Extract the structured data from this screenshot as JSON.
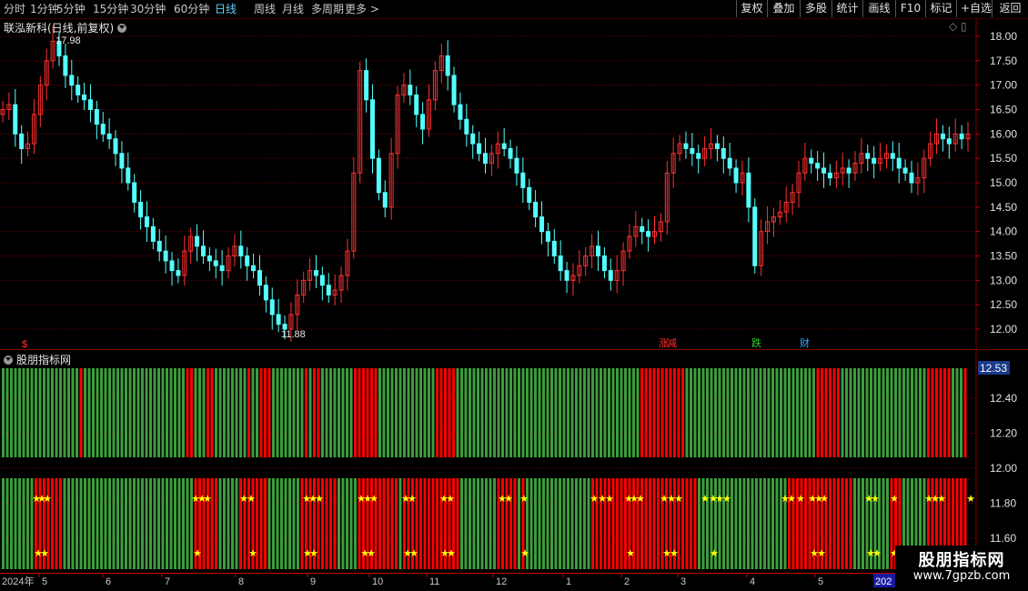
{
  "toolbar": {
    "timeframes": [
      {
        "label": "分时",
        "active": false
      },
      {
        "label": "1分钟",
        "active": false
      },
      {
        "label": "5分钟",
        "active": false
      },
      {
        "label": "15分钟",
        "active": false
      },
      {
        "label": "30分钟",
        "active": false
      },
      {
        "label": "60分钟",
        "active": false
      },
      {
        "label": "日线",
        "active": true
      },
      {
        "label": "周线",
        "active": false
      },
      {
        "label": "月线",
        "active": false
      },
      {
        "label": "多周期",
        "active": false
      },
      {
        "label": "更多 >",
        "active": false
      }
    ],
    "actions": [
      "复权",
      "叠加",
      "多股",
      "统计",
      "画线",
      "F10",
      "标记",
      "+自选",
      "返回"
    ]
  },
  "main_chart": {
    "title": "联泓新科(日线,前复权)",
    "high_label": "17.98",
    "low_label": "11.88",
    "events": [
      {
        "text": "涨",
        "color": "#ff3030"
      },
      {
        "text": "减",
        "color": "#ff3030"
      },
      {
        "text": "跌",
        "color": "#33cc33"
      },
      {
        "text": "财",
        "color": "#33aaff"
      }
    ],
    "dollar_marker": "$"
  },
  "indicator": {
    "title": "股朋指标网",
    "current_value": "12.53"
  },
  "x_axis": {
    "year_label": "2024年",
    "months": [
      "5",
      "6",
      "7",
      "8",
      "9",
      "10",
      "11",
      "12",
      "1",
      "2",
      "3",
      "4",
      "5"
    ],
    "partial_year": "202"
  },
  "watermark": {
    "title": "股朋指标网",
    "url": "www.7gpzb.com"
  },
  "colors": {
    "up": "#ff3030",
    "down": "#54ffff",
    "grid": "#7a0000",
    "bar_red": "#ff0000",
    "bar_green": "#3c9e3c",
    "star": "#ffff00"
  },
  "chart_data": {
    "type": "candlestick",
    "ylim": [
      11.7,
      18.2
    ],
    "y_ticks": [
      "18.00",
      "17.50",
      "17.00",
      "16.50",
      "16.00",
      "15.50",
      "15.00",
      "14.50",
      "14.00",
      "13.50",
      "13.00",
      "12.50",
      "12.00"
    ],
    "indicator_y_ticks": [
      "12.40",
      "12.20",
      "12.00",
      "11.80",
      "11.60"
    ],
    "close": [
      16.5,
      16.6,
      16.0,
      15.7,
      15.8,
      16.4,
      17.0,
      17.5,
      17.9,
      17.6,
      17.2,
      17.0,
      16.8,
      16.7,
      16.5,
      16.2,
      16.0,
      15.9,
      15.6,
      15.3,
      15.0,
      14.6,
      14.3,
      14.1,
      13.8,
      13.6,
      13.4,
      13.2,
      13.1,
      13.6,
      13.9,
      13.7,
      13.5,
      13.4,
      13.3,
      13.2,
      13.5,
      13.7,
      13.5,
      13.3,
      13.2,
      12.9,
      12.6,
      12.3,
      12.1,
      12.0,
      12.3,
      12.7,
      13.0,
      13.2,
      13.1,
      12.9,
      12.7,
      12.8,
      13.1,
      13.6,
      15.2,
      17.3,
      16.7,
      15.5,
      14.8,
      14.5,
      15.6,
      16.8,
      17.0,
      16.8,
      16.4,
      16.1,
      16.7,
      17.3,
      17.6,
      17.2,
      16.6,
      16.3,
      16.0,
      15.8,
      15.6,
      15.4,
      15.6,
      15.8,
      15.7,
      15.5,
      15.2,
      14.9,
      14.6,
      14.3,
      14.0,
      13.8,
      13.5,
      13.2,
      13.0,
      13.1,
      13.3,
      13.5,
      13.7,
      13.5,
      13.2,
      13.0,
      13.2,
      13.6,
      13.9,
      14.1,
      14.0,
      13.9,
      14.0,
      14.2,
      15.2,
      15.6,
      15.8,
      15.7,
      15.6,
      15.5,
      15.7,
      15.8,
      15.7,
      15.5,
      15.3,
      15.0,
      15.2,
      14.5,
      13.3,
      14.0,
      14.2,
      14.3,
      14.4,
      14.6,
      14.8,
      15.2,
      15.5,
      15.4,
      15.3,
      15.2,
      15.1,
      15.2,
      15.3,
      15.2,
      15.4,
      15.6,
      15.5,
      15.4,
      15.5,
      15.6,
      15.5,
      15.3,
      15.2,
      15.0,
      15.1,
      15.5,
      15.8,
      16.0,
      15.9,
      15.8,
      16.0,
      15.9,
      16.0
    ]
  }
}
